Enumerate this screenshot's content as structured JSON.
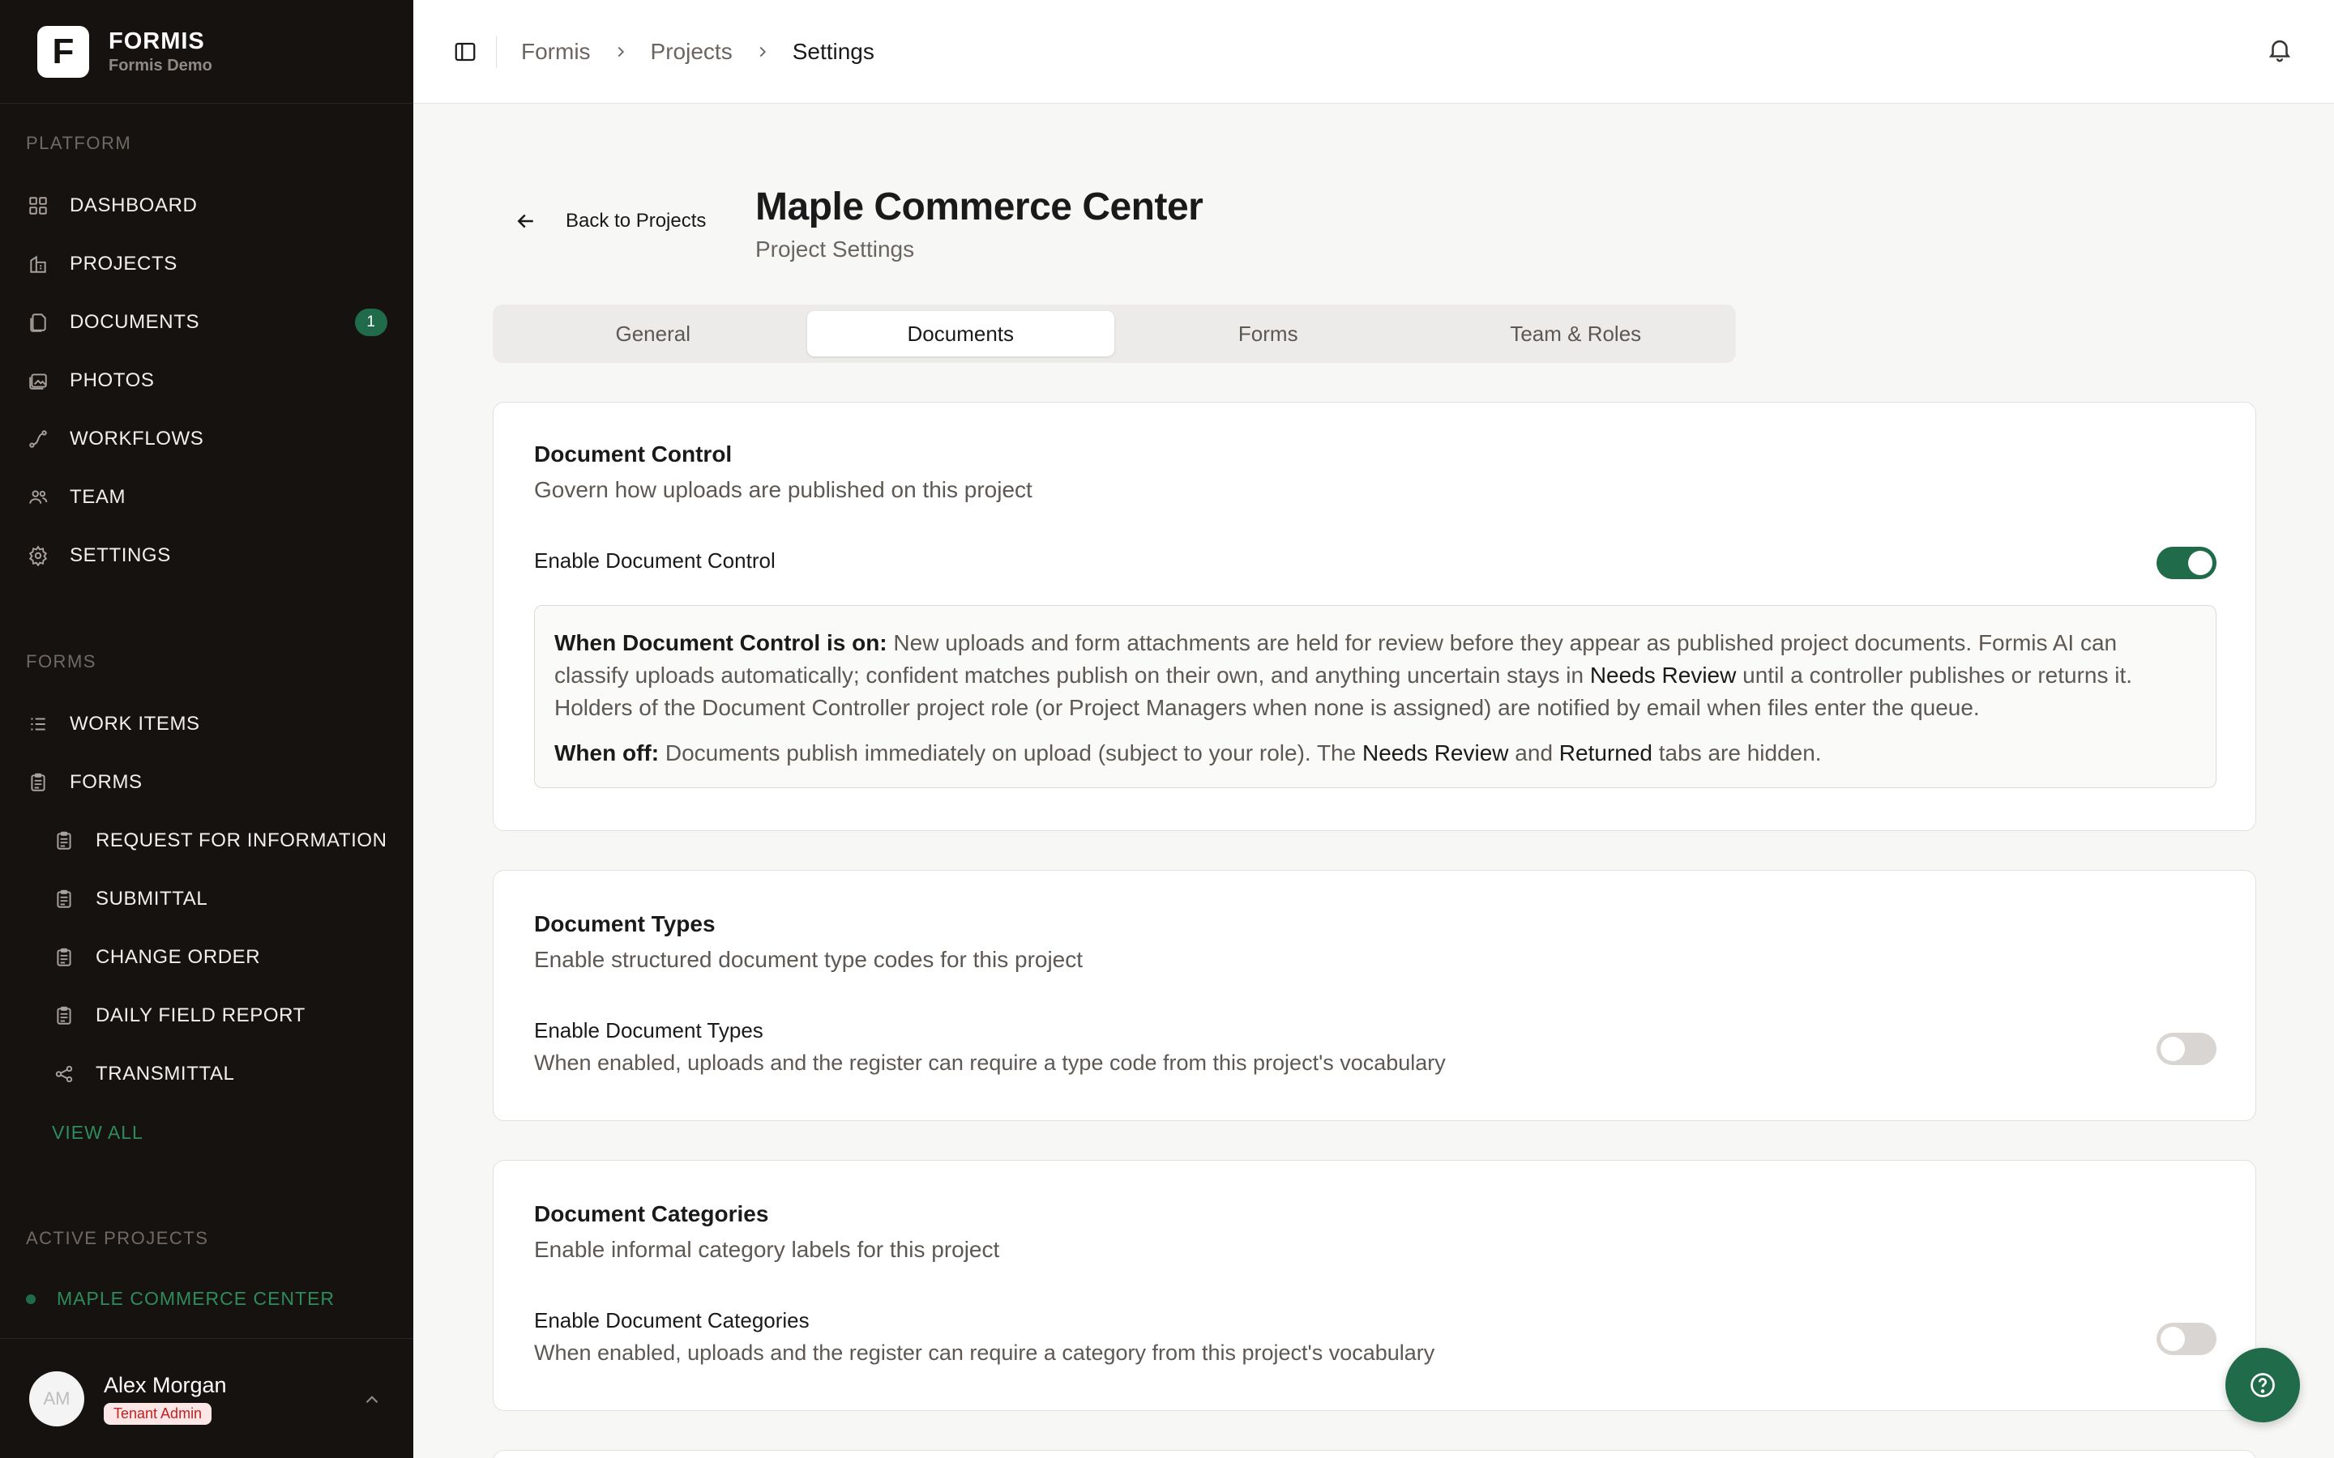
{
  "brand": {
    "logo_letter": "F",
    "name": "FORMIS",
    "subtitle": "Formis Demo"
  },
  "sidebar": {
    "platform_label": "PLATFORM",
    "platform_items": [
      {
        "label": "DASHBOARD",
        "icon": "grid-icon"
      },
      {
        "label": "PROJECTS",
        "icon": "building-icon"
      },
      {
        "label": "DOCUMENTS",
        "icon": "documents-icon",
        "badge": "1"
      },
      {
        "label": "PHOTOS",
        "icon": "photos-icon"
      },
      {
        "label": "WORKFLOWS",
        "icon": "workflow-icon"
      },
      {
        "label": "TEAM",
        "icon": "users-icon"
      },
      {
        "label": "SETTINGS",
        "icon": "gear-icon"
      }
    ],
    "forms_label": "FORMS",
    "forms_items": [
      {
        "label": "WORK ITEMS",
        "icon": "list-icon"
      },
      {
        "label": "FORMS",
        "icon": "clipboard-icon"
      }
    ],
    "form_sub_items": [
      {
        "label": "REQUEST FOR INFORMATION",
        "icon": "clipboard-icon"
      },
      {
        "label": "SUBMITTAL",
        "icon": "clipboard-icon"
      },
      {
        "label": "CHANGE ORDER",
        "icon": "clipboard-icon"
      },
      {
        "label": "DAILY FIELD REPORT",
        "icon": "clipboard-icon"
      },
      {
        "label": "TRANSMITTAL",
        "icon": "share-icon"
      }
    ],
    "view_all": "VIEW ALL",
    "active_projects_label": "ACTIVE PROJECTS",
    "active_project": "MAPLE COMMERCE CENTER"
  },
  "user": {
    "initials": "AM",
    "name": "Alex Morgan",
    "role": "Tenant Admin"
  },
  "breadcrumb": [
    "Formis",
    "Projects",
    "Settings"
  ],
  "page": {
    "back_label": "Back to Projects",
    "title": "Maple Commerce Center",
    "subtitle": "Project Settings"
  },
  "tabs": [
    "General",
    "Documents",
    "Forms",
    "Team & Roles"
  ],
  "active_tab": "Documents",
  "document_control": {
    "title": "Document Control",
    "description": "Govern how uploads are published on this project",
    "toggle_label": "Enable Document Control",
    "enabled": true,
    "info_on_lead": "When Document Control is on:",
    "info_on_text_1": " New uploads and form attachments are held for review before they appear as published project documents. Formis AI can classify uploads automatically; confident matches publish on their own, and anything uncertain stays in ",
    "info_on_needs_review": "Needs Review",
    "info_on_text_2": " until a controller publishes or returns it. Holders of the Document Controller project role (or Project Managers when none is assigned) are notified by email when files enter the queue.",
    "info_off_lead": "When off:",
    "info_off_text_1": " Documents publish immediately on upload (subject to your role). The ",
    "info_off_needs_review": "Needs Review",
    "info_off_and": " and ",
    "info_off_returned": "Returned",
    "info_off_text_2": " tabs are hidden."
  },
  "document_types": {
    "title": "Document Types",
    "description": "Enable structured document type codes for this project",
    "toggle_label": "Enable Document Types",
    "toggle_description": "When enabled, uploads and the register can require a type code from this project's vocabulary",
    "enabled": false
  },
  "document_categories": {
    "title": "Document Categories",
    "description": "Enable informal category labels for this project",
    "toggle_label": "Enable Document Categories",
    "toggle_description": "When enabled, uploads and the register can require a category from this project's vocabulary",
    "enabled": false
  },
  "colors": {
    "accent": "#1f6b4a",
    "sidebar_bg": "#161210",
    "role_badge_bg": "#fde6e6",
    "role_badge_text": "#c21f1f"
  }
}
